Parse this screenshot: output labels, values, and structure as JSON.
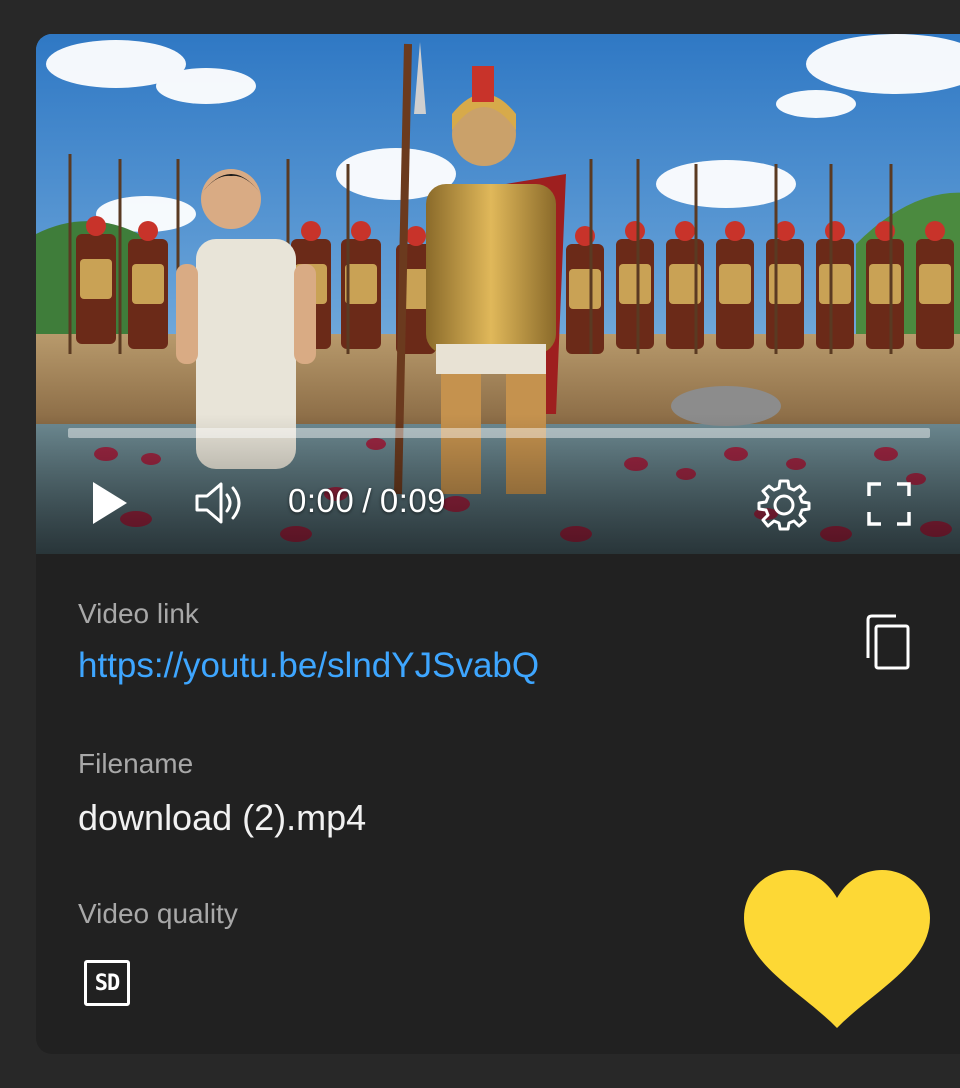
{
  "player": {
    "current_time": "0:00",
    "separator": "/",
    "duration": "0:09",
    "progress_fraction": 0.0,
    "icons": {
      "play": "play-icon",
      "volume": "volume-icon",
      "settings": "gear-icon",
      "fullscreen": "fullscreen-icon"
    }
  },
  "details": {
    "video_link_label": "Video link",
    "video_link": "https://youtu.be/slndYJSvabQ",
    "filename_label": "Filename",
    "filename": "download (2).mp4",
    "quality_label": "Video quality",
    "quality_badge": "SD"
  },
  "colors": {
    "link": "#3ea6ff",
    "heart": "#fdd835",
    "card_bg": "#212121",
    "page_bg": "#282828"
  }
}
